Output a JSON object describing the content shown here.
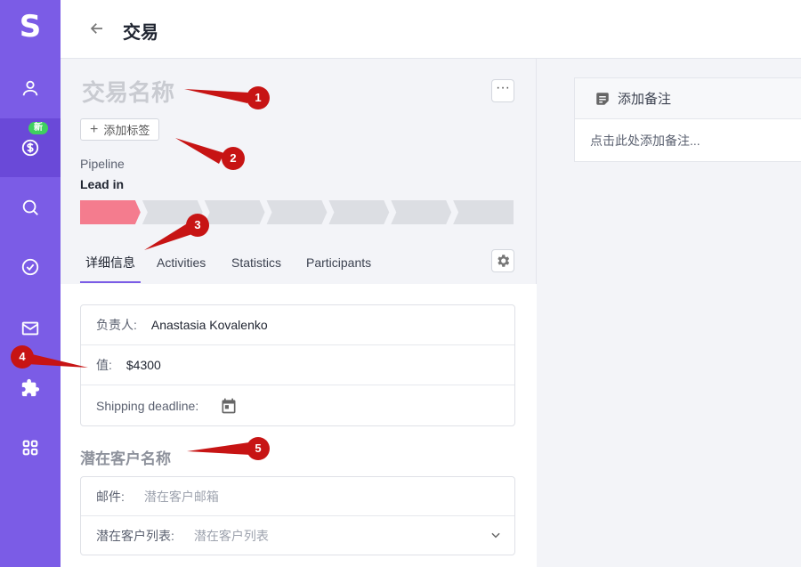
{
  "sidebar": {
    "logo": "S",
    "new_badge": "新",
    "items": [
      {
        "icon": "person-icon"
      },
      {
        "icon": "dollar-icon"
      },
      {
        "icon": "search-icon"
      },
      {
        "icon": "check-circle-icon"
      },
      {
        "icon": "mail-icon"
      },
      {
        "icon": "puzzle-icon"
      },
      {
        "icon": "apps-grid-icon"
      }
    ]
  },
  "header": {
    "title": "交易"
  },
  "deal": {
    "name_placeholder": "交易名称",
    "more_label": "···",
    "add_tag_label": "添加标签",
    "pipeline_label": "Pipeline",
    "pipeline_stage": "Lead in",
    "stages_total": 7,
    "stages_active": 1
  },
  "tabs": [
    {
      "label": "详细信息",
      "active": true
    },
    {
      "label": "Activities",
      "active": false
    },
    {
      "label": "Statistics",
      "active": false
    },
    {
      "label": "Participants",
      "active": false
    }
  ],
  "details": {
    "owner_label": "负责人:",
    "owner_value": "Anastasia Kovalenko",
    "value_label": "值:",
    "value_value": "$4300",
    "deadline_label": "Shipping deadline:"
  },
  "lead": {
    "title": "潜在客户名称",
    "email_label": "邮件:",
    "email_placeholder": "潜在客户邮箱",
    "list_label": "潜在客户列表:",
    "list_placeholder": "潜在客户列表"
  },
  "notes": {
    "title": "添加备注",
    "placeholder": "点击此处添加备注..."
  },
  "callouts": [
    "1",
    "2",
    "3",
    "4",
    "5"
  ],
  "colors": {
    "sidebar": "#7b5ce6",
    "sidebar_active": "#6a49d8",
    "stage_active": "#f47c8e",
    "stage_inactive": "#dcdee3",
    "callout": "#c71414"
  }
}
